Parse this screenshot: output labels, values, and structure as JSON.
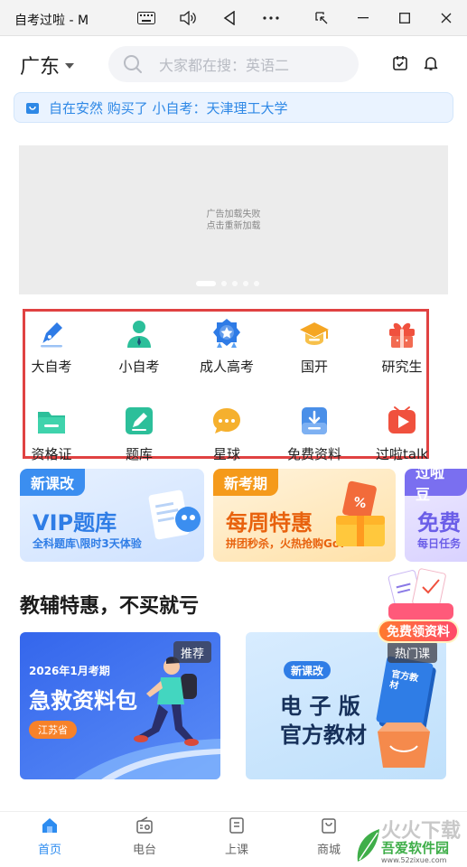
{
  "window": {
    "title": "自考过啦 - M"
  },
  "header": {
    "city": "广东",
    "search_placeholder": "大家都在搜：英语二"
  },
  "ticker": {
    "text": "自在安然 购买了 小自考：天津理工大学"
  },
  "banner": {
    "fail_line1": "广告加载失败",
    "fail_line2": "点击重新加载",
    "slide_count": 5,
    "active_slide": 1
  },
  "nav": {
    "row1": [
      {
        "label": "大自考",
        "icon": "pen-nib-icon",
        "color": "#2e7be6"
      },
      {
        "label": "小自考",
        "icon": "student-icon",
        "color": "#2cbf9a"
      },
      {
        "label": "成人高考",
        "icon": "medal-icon",
        "color": "#2e7be6"
      },
      {
        "label": "国开",
        "icon": "graduation-cap-icon",
        "color": "#f5a623"
      },
      {
        "label": "研究生",
        "icon": "gift-box-icon",
        "color": "#f0513e"
      }
    ],
    "row2": [
      {
        "label": "资格证",
        "icon": "folder-icon",
        "color": "#2cbf9a"
      },
      {
        "label": "题库",
        "icon": "edit-icon",
        "color": "#2cbf9a"
      },
      {
        "label": "星球",
        "icon": "chat-bubble-icon",
        "color": "#f5a623"
      },
      {
        "label": "免费资料",
        "icon": "download-icon",
        "color": "#4a8fe8"
      },
      {
        "label": "过啦talk",
        "icon": "play-icon",
        "color": "#f0513e"
      }
    ]
  },
  "promos": [
    {
      "tag": "新课改",
      "title": "VIP题库",
      "subtitle": "全科题库\\限时3天体验",
      "accent": "#3b8ef0"
    },
    {
      "tag": "新考期",
      "title": "每周特惠",
      "subtitle": "拼团秒杀，火热抢购Go!",
      "accent": "#f59a1b"
    },
    {
      "tag": "过啦豆",
      "title": "免费",
      "subtitle": "每日任务",
      "accent": "#7a6ff0"
    }
  ],
  "section": {
    "title": "教辅特惠，不买就亏"
  },
  "products": [
    {
      "badge": "推荐",
      "line1": "2026年1月考期",
      "line2": "急救资料包",
      "region": "江苏省"
    },
    {
      "badge": "热门课",
      "tag": "新课改",
      "line1": "电 子 版",
      "line2": "官方教材",
      "book": "官方教材"
    }
  ],
  "floating": {
    "label": "免费领资料"
  },
  "tabs": [
    {
      "label": "首页",
      "icon": "home-icon",
      "active": true
    },
    {
      "label": "电台",
      "icon": "radio-icon",
      "active": false
    },
    {
      "label": "上课",
      "icon": "class-icon",
      "active": false
    },
    {
      "label": "商城",
      "icon": "shop-icon",
      "active": false
    }
  ],
  "watermark": {
    "big": "火火下载",
    "name": "吾爱软件园",
    "url": "www.52zixue.com"
  }
}
